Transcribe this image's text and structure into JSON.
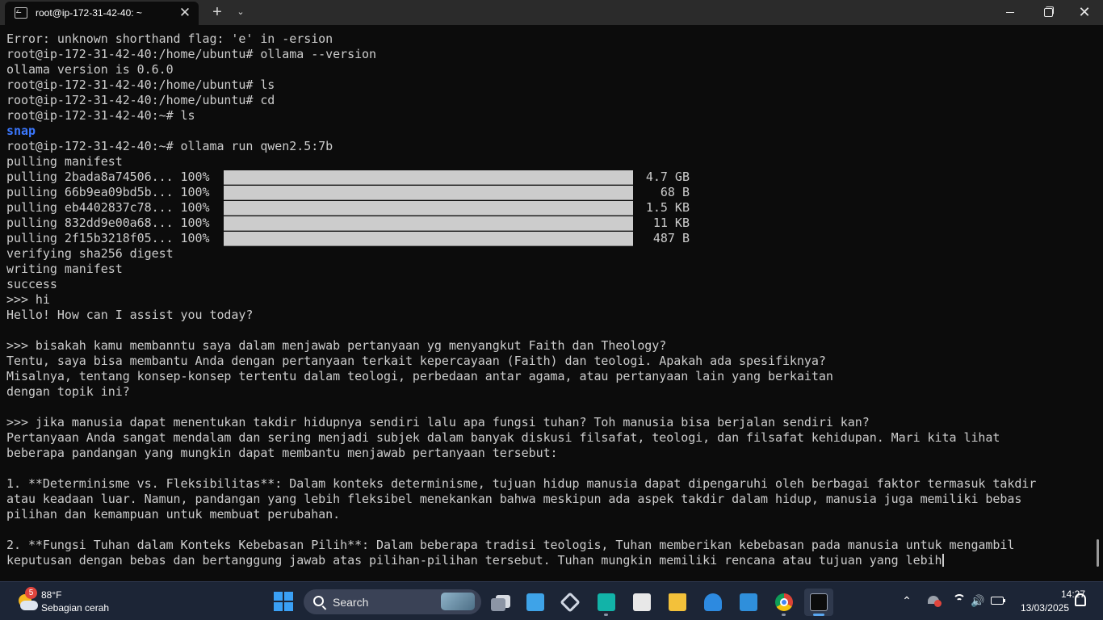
{
  "window": {
    "tab_title": "root@ip-172-31-42-40: ~",
    "tab_close": "✕",
    "new_tab": "+",
    "tab_menu": "⌄",
    "close_glyph": "✕"
  },
  "terminal": {
    "lines": [
      "Error: unknown shorthand flag: 'e' in -ersion",
      "root@ip-172-31-42-40:/home/ubuntu# ollama --version",
      "ollama version is 0.6.0",
      "root@ip-172-31-42-40:/home/ubuntu# ls",
      "root@ip-172-31-42-40:/home/ubuntu# cd",
      "root@ip-172-31-42-40:~# ls",
      "snap",
      "root@ip-172-31-42-40:~# ollama run qwen2.5:7b",
      "pulling manifest",
      "pulling 2bada8a74506... 100%",
      "pulling 66b9ea09bd5b... 100%",
      "pulling eb4402837c78... 100%",
      "pulling 832dd9e00a68... 100%",
      "pulling 2f15b3218f05... 100%",
      "verifying sha256 digest",
      "writing manifest",
      "success",
      ">>> hi",
      "Hello! How can I assist you today?",
      "",
      ">>> bisakah kamu membanntu saya dalam menjawab pertanyaan yg menyangkut Faith dan Theology?",
      "Tentu, saya bisa membantu Anda dengan pertanyaan terkait kepercayaan (Faith) dan teologi. Apakah ada spesifiknya?",
      "Misalnya, tentang konsep-konsep tertentu dalam teologi, perbedaan antar agama, atau pertanyaan lain yang berkaitan",
      "dengan topik ini?",
      "",
      ">>> jika manusia dapat menentukan takdir hidupnya sendiri lalu apa fungsi tuhan? Toh manusia bisa berjalan sendiri kan?",
      "Pertanyaan Anda sangat mendalam dan sering menjadi subjek dalam banyak diskusi filsafat, teologi, dan filsafat kehidupan. Mari kita lihat",
      "beberapa pandangan yang mungkin dapat membantu menjawab pertanyaan tersebut:",
      "",
      "1. **Determinisme vs. Fleksibilitas**: Dalam konteks determinisme, tujuan hidup manusia dapat dipengaruhi oleh berbagai faktor termasuk takdir",
      "atau keadaan luar. Namun, pandangan yang lebih fleksibel menekankan bahwa meskipun ada aspek takdir dalam hidup, manusia juga memiliki bebas",
      "pilihan dan kemampuan untuk membuat perubahan.",
      "",
      "2. **Fungsi Tuhan dalam Konteks Kebebasan Pilih**: Dalam beberapa tradisi teologis, Tuhan memberikan kebebasan pada manusia untuk mengambil",
      "keputusan dengan bebas dan bertanggung jawab atas pilihan-pilihan tersebut. Tuhan mungkin memiliki rencana atau tujuan yang lebih"
    ],
    "pulls": [
      {
        "size": "4.7 GB",
        "progress": 1.0
      },
      {
        "size": "68 B",
        "progress": 1.0
      },
      {
        "size": "1.5 KB",
        "progress": 1.0
      },
      {
        "size": "11 KB",
        "progress": 1.0
      },
      {
        "size": "487 B",
        "progress": 1.0
      }
    ]
  },
  "taskbar": {
    "weather": {
      "badge": "5",
      "temp": "88°F",
      "desc": "Sebagian cerah"
    },
    "search_label": "Search",
    "tray": {
      "chevron": "⌃",
      "speaker": "🔊"
    },
    "clock": {
      "time": "14:27",
      "date": "13/03/2025"
    }
  }
}
